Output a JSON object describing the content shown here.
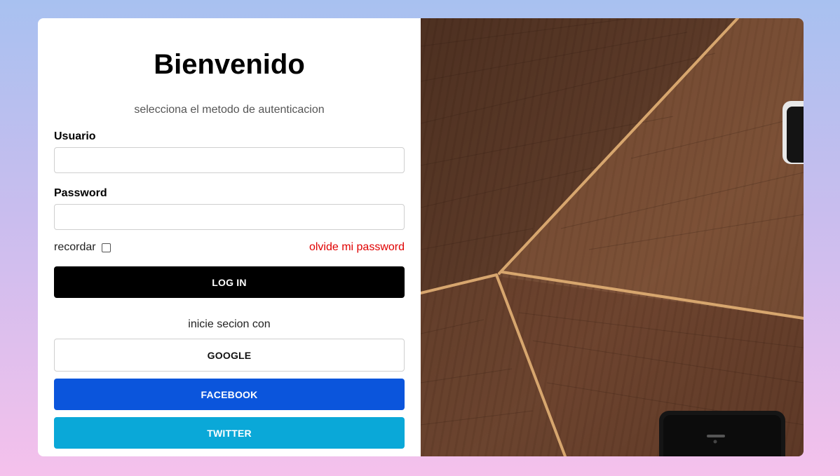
{
  "form": {
    "title": "Bienvenido",
    "subtitle": "selecciona el metodo de autenticacion",
    "username_label": "Usuario",
    "username_value": "",
    "password_label": "Password",
    "password_value": "",
    "remember_label": "recordar",
    "remember_checked": false,
    "forgot_link": "olvide mi password",
    "login_button": "LOG IN",
    "social_prompt": "inicie secion con",
    "google_button": "GOOGLE",
    "facebook_button": "FACEBOOK",
    "twitter_button": "TWITTER"
  },
  "colors": {
    "login_button": "#000000",
    "facebook_button": "#0b55dc",
    "twitter_button": "#0aa8d8",
    "forgot_link": "#e00000"
  },
  "image": {
    "subject": "wooden table with phones"
  }
}
